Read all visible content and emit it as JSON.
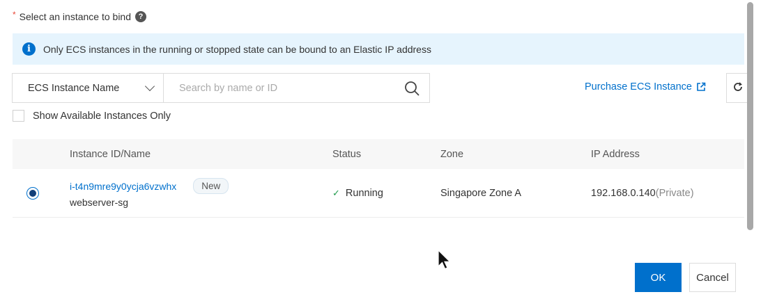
{
  "form": {
    "required_mark": "*",
    "label": "Select an instance to bind",
    "help_glyph": "?"
  },
  "notice": {
    "icon_glyph": "i",
    "text": "Only ECS instances in the running or stopped state can be bound to an Elastic IP address"
  },
  "search": {
    "filter_selected": "ECS Instance Name",
    "placeholder": "Search by name or ID",
    "value": ""
  },
  "purchase_link": "Purchase ECS Instance",
  "filter_checkbox": {
    "label": "Show Available Instances Only",
    "checked": false
  },
  "table": {
    "headers": [
      "Instance ID/Name",
      "Status",
      "Zone",
      "IP Address"
    ],
    "rows": [
      {
        "selected": true,
        "instance_id": "i-t4n9mre9y0ycja6vzwhx",
        "tag": "New",
        "instance_name": "webserver-sg",
        "status": "Running",
        "zone": "Singapore Zone A",
        "ip": "192.168.0.140",
        "ip_type": "(Private)"
      }
    ]
  },
  "footer": {
    "ok_label": "OK",
    "cancel_label": "Cancel"
  },
  "colors": {
    "primary": "#0070cc",
    "notice_bg": "#e6f4fd",
    "required": "#e84738",
    "success": "#1e9a4b"
  }
}
